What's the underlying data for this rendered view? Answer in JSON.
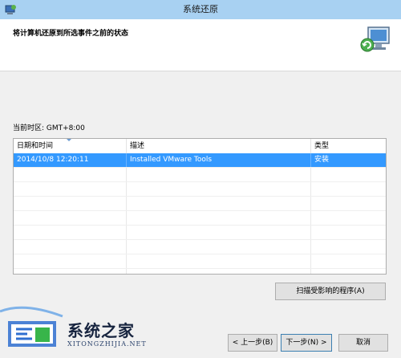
{
  "window": {
    "title": "系统还原"
  },
  "header": {
    "heading": "将计算机还原到所选事件之前的状态"
  },
  "timezone": {
    "label": "当前时区: GMT+8:00"
  },
  "table": {
    "columns": [
      "日期和时间",
      "描述",
      "类型"
    ],
    "rows": [
      {
        "date": "2014/10/8 12:20:11",
        "description": "Installed VMware Tools",
        "type": "安装",
        "selected": true
      }
    ],
    "empty_rows": 8
  },
  "buttons": {
    "scan": "扫描受影响的程序(A)",
    "back": "< 上一步(B)",
    "next": "下一步(N) >",
    "cancel": "取消"
  },
  "watermark": {
    "brand": "系统之家",
    "url": "XITONGZHIJIA.NET"
  },
  "colors": {
    "titlebar": "#a8d1f2",
    "selection": "#3399ff"
  },
  "icons": {
    "app": "system-restore-icon",
    "header": "computer-restore-icon"
  }
}
